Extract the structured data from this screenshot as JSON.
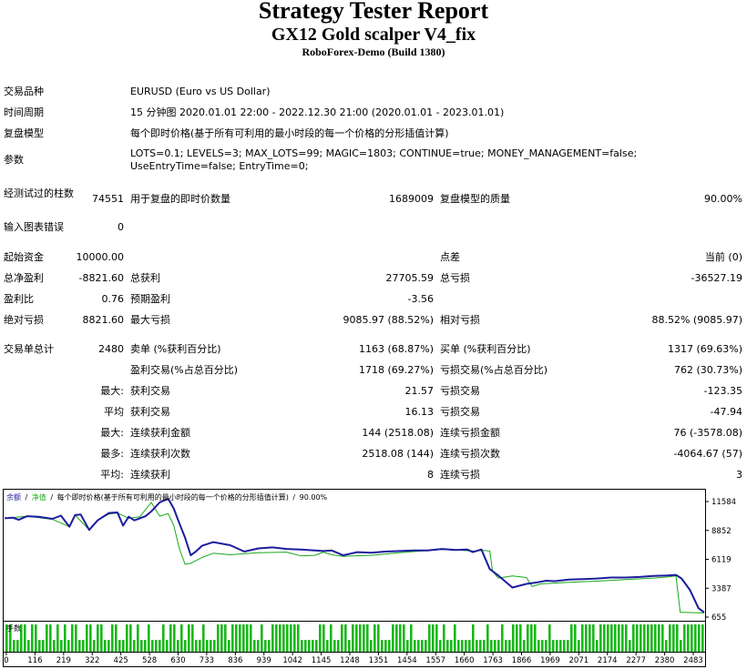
{
  "header": {
    "title": "Strategy Tester Report",
    "ea_name": "GX12 Gold scalper V4_fix",
    "server": "RoboForex-Demo (Build 1380)"
  },
  "settings": {
    "symbol_label": "交易品种",
    "symbol_value": "EURUSD (Euro vs US Dollar)",
    "period_label": "时间周期",
    "period_value": "15 分钟图 2020.01.01 22:00 - 2022.12.30 21:00 (2020.01.01 - 2023.01.01)",
    "model_label": "复盘模型",
    "model_value": "每个即时价格(基于所有可利用的最小时段的每一个价格的分形插值计算)",
    "params_label": "参数",
    "params_value": "LOTS=0.1; LEVELS=3; MAX_LOTS=99; MAGIC=1803; CONTINUE=true; MONEY_MANAGEMENT=false; UseEntryTime=false; EntryTime=0;"
  },
  "test": {
    "bars_label": "经测试过的柱数",
    "bars_value": "74551",
    "ticks_label": "用于复盘的即时价数量",
    "ticks_value": "1689009",
    "quality_label": "复盘模型的质量",
    "quality_value": "90.00%",
    "errors_label": "输入图表错误",
    "errors_value": "0"
  },
  "results": {
    "deposit_label": "起始资金",
    "deposit_value": "10000.00",
    "spread_label": "点差",
    "spread_value": "当前 (0)",
    "net_label": "总净盈利",
    "net_value": "-8821.60",
    "gross_profit_label": "总获利",
    "gross_profit_value": "27705.59",
    "gross_loss_label": "总亏损",
    "gross_loss_value": "-36527.19",
    "pf_label": "盈利比",
    "pf_value": "0.76",
    "payoff_label": "预期盈利",
    "payoff_value": "-3.56",
    "abs_dd_label": "绝对亏损",
    "abs_dd_value": "8821.60",
    "max_dd_label": "最大亏损",
    "max_dd_value": "9085.97 (88.52%)",
    "rel_dd_label": "相对亏损",
    "rel_dd_value": "88.52% (9085.97)"
  },
  "trades": {
    "total_label": "交易单总计",
    "total_value": "2480",
    "short_label": "卖单 (%获利百分比)",
    "short_value": "1163 (68.87%)",
    "long_label": "买单 (%获利百分比)",
    "long_value": "1317 (69.63%)",
    "profit_trades_label": "盈利交易(%占总百分比)",
    "profit_trades_value": "1718 (69.27%)",
    "loss_trades_label": "亏损交易(%占总百分比)",
    "loss_trades_value": "762 (30.73%)",
    "largest_label": "最大:",
    "largest_profit_label": "获利交易",
    "largest_profit_value": "21.57",
    "largest_loss_label": "亏损交易",
    "largest_loss_value": "-123.35",
    "average_label": "平均",
    "avg_profit_label": "获利交易",
    "avg_profit_value": "16.13",
    "avg_loss_label": "亏损交易",
    "avg_loss_value": "-47.94",
    "max_label": "最大:",
    "max_wins_label": "连续获利金额",
    "max_wins_value": "144 (2518.08)",
    "max_losses_label": "连续亏损金额",
    "max_losses_value": "76 (-3578.08)",
    "maximal_label": "最多:",
    "maximal_profit_label": "连续获利次数",
    "maximal_profit_value": "2518.08 (144)",
    "maximal_loss_label": "连续亏损次数",
    "maximal_loss_value": "-4064.67 (57)",
    "avg_cons_label": "平均:",
    "avg_cons_wins_label": "连续获利",
    "avg_cons_wins_value": "8",
    "avg_cons_losses_label": "连续亏损",
    "avg_cons_losses_value": "3"
  },
  "chart_data": {
    "type": "line",
    "legend": {
      "balance": "余额",
      "sep1": "/",
      "equity": "净值",
      "sep2": "/",
      "model": "每个即时价格(基于所有可利用的最小时段的每一个价格的分形插值计算)",
      "sep3": "/",
      "quality": "90.00%"
    },
    "y_ticks": [
      "11584",
      "8852",
      "6119",
      "3387",
      "655"
    ],
    "ylim": [
      655,
      11584
    ],
    "x_ticks": [
      "0",
      "116",
      "219",
      "322",
      "425",
      "528",
      "630",
      "733",
      "836",
      "939",
      "1042",
      "1145",
      "1248",
      "1351",
      "1454",
      "1557",
      "1660",
      "1763",
      "1866",
      "1969",
      "2071",
      "2174",
      "2277",
      "2380",
      "2483"
    ],
    "xlim": [
      0,
      2480
    ],
    "volume_label": "手数",
    "colors": {
      "balance": "#1c1c9e",
      "equity": "#18a818",
      "volume": "#18b818"
    },
    "series": [
      {
        "name": "余额",
        "x": [
          0,
          30,
          50,
          80,
          120,
          170,
          200,
          230,
          250,
          270,
          300,
          330,
          370,
          400,
          420,
          440,
          460,
          480,
          500,
          520,
          550,
          580,
          600,
          620,
          640,
          660,
          680,
          700,
          740,
          800,
          850,
          900,
          950,
          1000,
          1050,
          1100,
          1130,
          1160,
          1200,
          1250,
          1300,
          1350,
          1400,
          1450,
          1500,
          1550,
          1600,
          1640,
          1660,
          1690,
          1720,
          1750,
          1800,
          1850,
          1890,
          1920,
          1950,
          2000,
          2050,
          2100,
          2150,
          2200,
          2250,
          2300,
          2350,
          2380,
          2400,
          2430,
          2460,
          2480
        ],
        "y": [
          10000,
          10050,
          9850,
          10200,
          10150,
          9950,
          10250,
          9200,
          10300,
          10350,
          8900,
          9800,
          10500,
          10550,
          9300,
          10150,
          9800,
          10000,
          10200,
          10650,
          11500,
          11850,
          10900,
          9500,
          8150,
          6500,
          6900,
          7400,
          7750,
          7450,
          6850,
          7150,
          7250,
          7100,
          7050,
          6950,
          6900,
          6950,
          6500,
          6800,
          6750,
          6850,
          6900,
          6950,
          6950,
          7100,
          7000,
          7050,
          6800,
          7050,
          5200,
          4600,
          3450,
          3800,
          3950,
          4100,
          4050,
          4200,
          4250,
          4300,
          4400,
          4400,
          4450,
          4550,
          4600,
          4650,
          4300,
          3200,
          1500,
          1100
        ]
      },
      {
        "name": "净值",
        "x": [
          0,
          80,
          170,
          230,
          250,
          300,
          330,
          370,
          400,
          440,
          480,
          520,
          550,
          580,
          600,
          620,
          640,
          660,
          700,
          740,
          800,
          900,
          1000,
          1050,
          1100,
          1130,
          1160,
          1200,
          1300,
          1400,
          1500,
          1550,
          1600,
          1660,
          1700,
          1720,
          1730,
          1750,
          1800,
          1850,
          1870,
          1900,
          2000,
          2100,
          2200,
          2300,
          2350,
          2380,
          2395,
          2400,
          2480
        ],
        "y": [
          10000,
          10200,
          9900,
          9200,
          10300,
          8900,
          9800,
          10400,
          10500,
          10000,
          10150,
          11500,
          10200,
          10450,
          9300,
          7100,
          5650,
          5750,
          6300,
          6700,
          6550,
          6750,
          6800,
          6450,
          6500,
          6800,
          6550,
          6400,
          6500,
          6750,
          6950,
          7050,
          7000,
          6900,
          6950,
          6900,
          5000,
          4350,
          4550,
          4400,
          3550,
          3800,
          3950,
          4050,
          4200,
          4350,
          4450,
          4550,
          1100,
          1100,
          1050
        ]
      }
    ]
  }
}
